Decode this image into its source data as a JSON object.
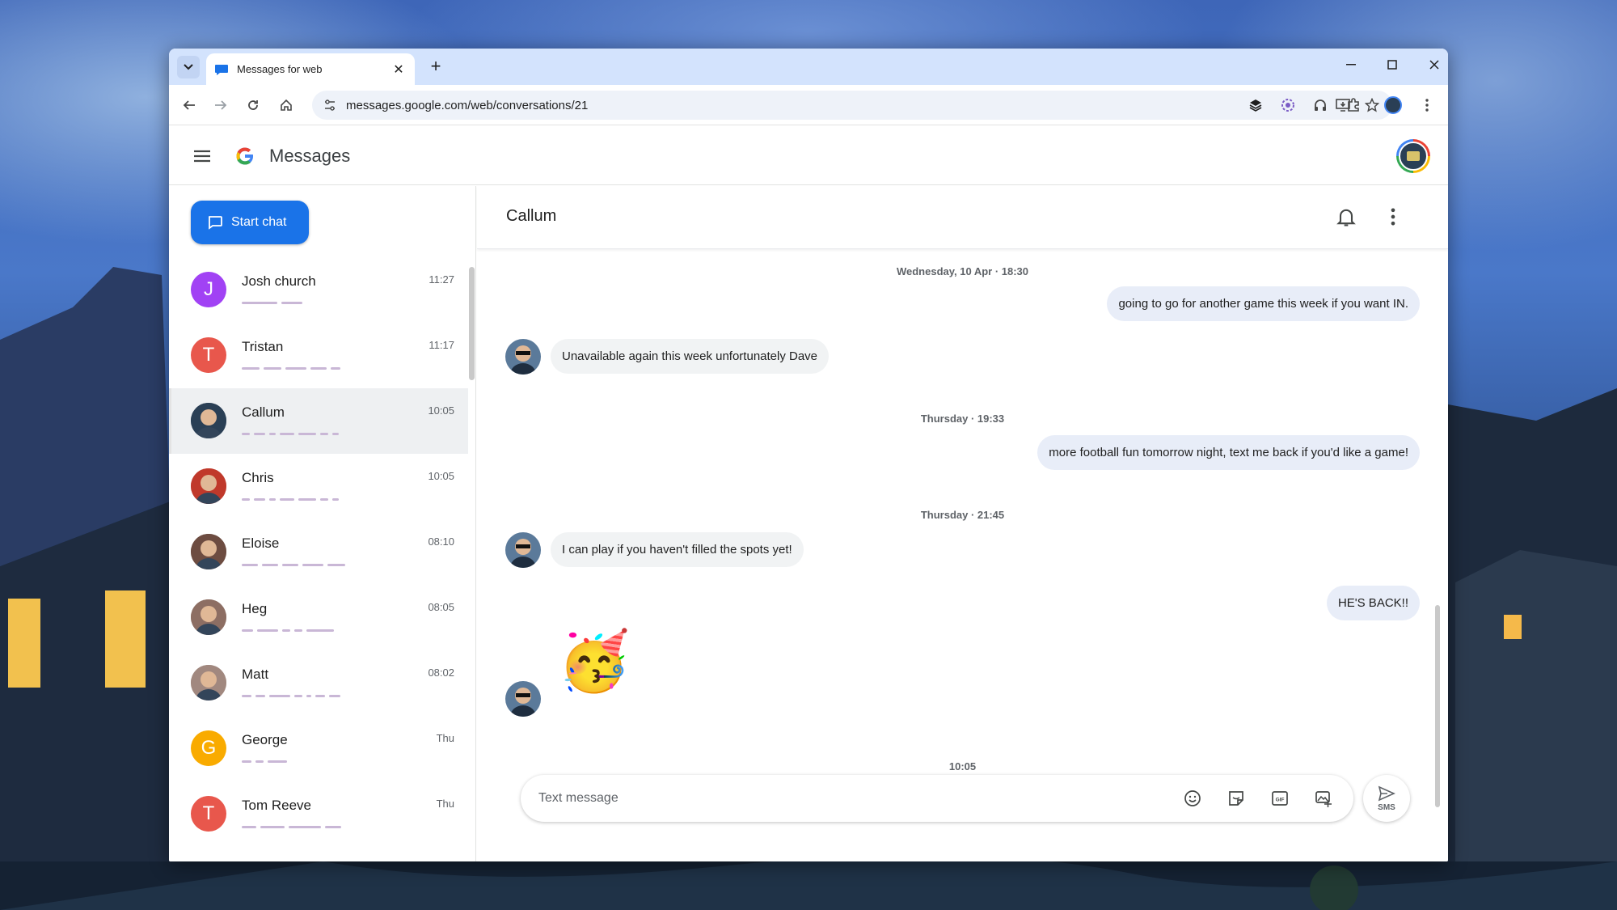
{
  "browser": {
    "tab_title": "Messages for web",
    "url": "messages.google.com/web/conversations/21"
  },
  "app": {
    "name": "Messages",
    "start_chat_label": "Start chat"
  },
  "conversations": [
    {
      "name": "Josh church",
      "time": "11:27",
      "initial": "J",
      "color": "#a142f4"
    },
    {
      "name": "Tristan",
      "time": "11:17",
      "initial": "T",
      "color": "#e8574c"
    },
    {
      "name": "Callum",
      "time": "10:05",
      "initial": "",
      "color": "#2a3f55"
    },
    {
      "name": "Chris",
      "time": "10:05",
      "initial": "",
      "color": "#c0392b"
    },
    {
      "name": "Eloise",
      "time": "08:10",
      "initial": "",
      "color": "#6d4c41"
    },
    {
      "name": "Heg",
      "time": "08:05",
      "initial": "",
      "color": "#8d6e63"
    },
    {
      "name": "Matt",
      "time": "08:02",
      "initial": "",
      "color": "#a1887f"
    },
    {
      "name": "George",
      "time": "Thu",
      "initial": "G",
      "color": "#f9ab00"
    },
    {
      "name": "Tom Reeve",
      "time": "Thu",
      "initial": "T",
      "color": "#e8574c"
    }
  ],
  "chat": {
    "title": "Callum",
    "messages": [
      {
        "type": "date",
        "text": "Wednesday, 10 Apr · 18:30"
      },
      {
        "type": "out",
        "text": "going to go for another game this week if you want IN."
      },
      {
        "type": "in",
        "text": "Unavailable again this week unfortunately Dave"
      },
      {
        "type": "date",
        "text": "Thursday · 19:33"
      },
      {
        "type": "out",
        "text": "more football fun tomorrow night, text me back if you'd like a game!"
      },
      {
        "type": "date",
        "text": "Thursday · 21:45"
      },
      {
        "type": "in",
        "text": "I can play if you haven't filled the spots yet!"
      },
      {
        "type": "out",
        "text": "HE'S BACK!!"
      },
      {
        "type": "in-emoji",
        "text": "🥳"
      },
      {
        "type": "date",
        "text": "10:05"
      }
    ],
    "composer_placeholder": "Text message",
    "send_label": "SMS"
  }
}
